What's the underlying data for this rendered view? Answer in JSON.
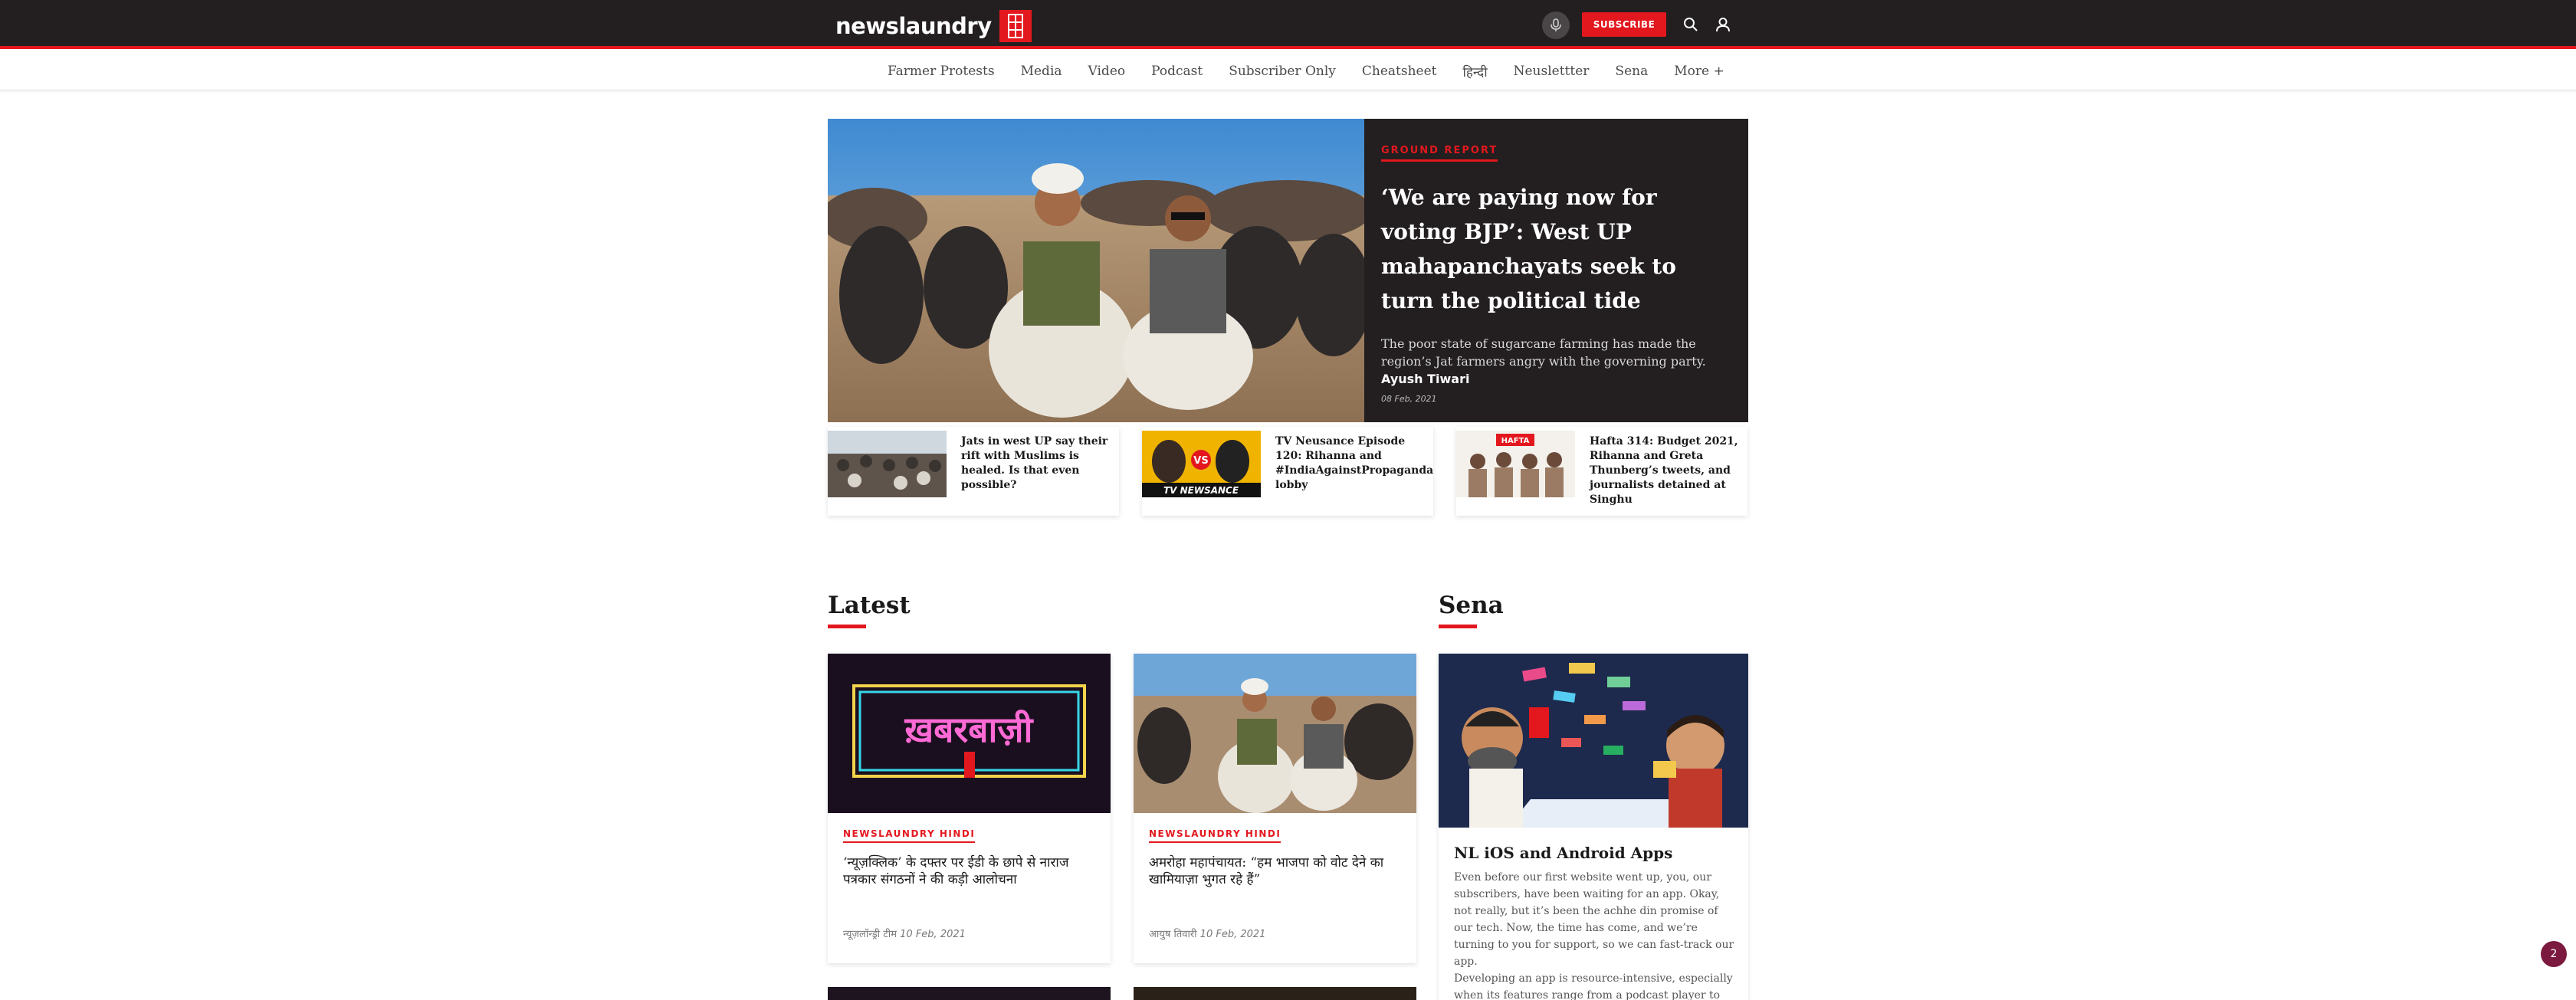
{
  "header": {
    "logo_text": "newslaundry",
    "subscribe_label": "SUBSCRIBE"
  },
  "nav": {
    "items": [
      "Farmer Protests",
      "Media",
      "Video",
      "Podcast",
      "Subscriber Only",
      "Cheatsheet",
      "हिन्दी",
      "Neuslettter",
      "Sena",
      "More +"
    ]
  },
  "hero": {
    "tag": "GROUND REPORT",
    "title": "‘We are paying now for voting BJP’: West UP mahapanchayats seek to turn the political tide",
    "description": "The poor state of sugarcane farming has made the region’s Jat farmers angry with the governing party.",
    "author": "Ayush Tiwari",
    "date": "08 Feb, 2021"
  },
  "mini_cards": [
    {
      "title": "Jats in west UP say their rift with Muslims is healed. Is that even possible?"
    },
    {
      "title": "TV Neusance Episode 120: Rihanna and #IndiaAgainstPropaganda lobby",
      "thumb_text": "TV NEWSANCE",
      "thumb_badge": "VS"
    },
    {
      "title": "Hafta 314: Budget 2021, Rihanna and Greta Thunberg’s tweets, and journalists detained at Singhu",
      "thumb_text": "HAFTA"
    }
  ],
  "sections": {
    "latest": "Latest",
    "sena": "Sena"
  },
  "latest_cards": [
    {
      "image_text": "ख़बरबाज़ी",
      "tag": "NEWSLAUNDRY HINDI",
      "title": "‘न्यूज़क्लिक’ के दफ्तर पर ईडी के छापे से नाराज पत्रकार संगठनों ने की कड़ी आलोचना",
      "author": "न्यूज़लॉन्ड्री टीम",
      "date": "10 Feb, 2021"
    },
    {
      "tag": "NEWSLAUNDRY HINDI",
      "title": "अमरोहा महापंचायत: “हम भाजपा को वोट देने का खामियाज़ा भुगत रहे हैं”",
      "author": "आयुष तिवारी",
      "date": "10 Feb, 2021"
    }
  ],
  "sena_card": {
    "title": "NL iOS and Android Apps",
    "body1": "Even before our first website went up, you, our subscribers, have been waiting for an app. Okay, not really, but it’s been the achhe din promise of our tech. Now, the time has come, and we’re turning to you for support, so we can fast-track our app.",
    "body2": "Developing an app is resource-intensive, especially when its features range from a podcast player to"
  },
  "notification_count": "2",
  "colors": {
    "brand_red": "#e3181e",
    "dark": "#231f20"
  }
}
